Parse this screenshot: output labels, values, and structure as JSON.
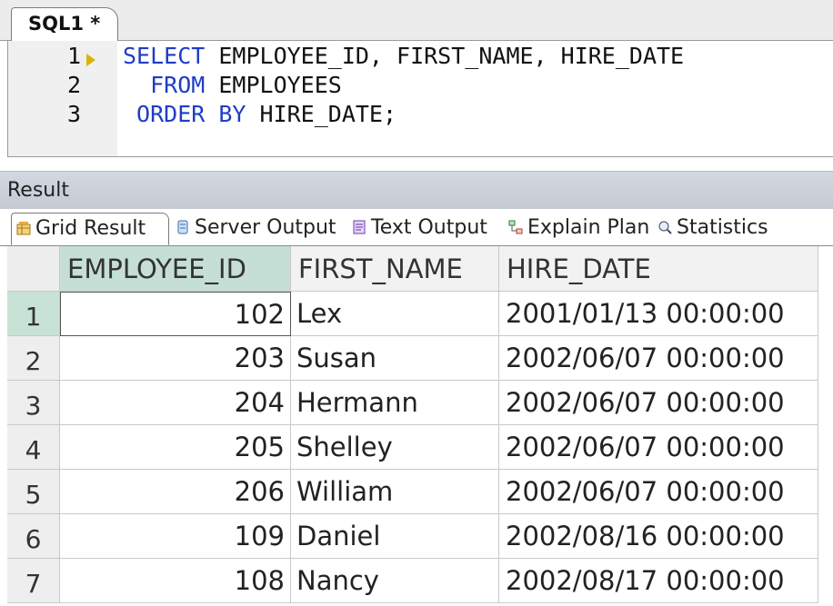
{
  "editor_tab": {
    "label": "SQL1 *"
  },
  "editor": {
    "lines": [
      {
        "num": "1",
        "parts": [
          {
            "text": "SELECT",
            "kw": true
          },
          {
            "text": " EMPLOYEE_ID, FIRST_NAME, HIRE_DATE",
            "kw": false
          }
        ]
      },
      {
        "num": "2",
        "parts": [
          {
            "text": "  FROM",
            "kw": true
          },
          {
            "text": " EMPLOYEES",
            "kw": false
          }
        ]
      },
      {
        "num": "3",
        "parts": [
          {
            "text": " ORDER BY",
            "kw": true
          },
          {
            "text": " HIRE_DATE;",
            "kw": false
          }
        ]
      }
    ]
  },
  "result": {
    "title": "Result",
    "tabs": [
      {
        "label": "Grid Result",
        "icon": "grid-result-icon",
        "active": true
      },
      {
        "label": "Server Output",
        "icon": "server-output-icon",
        "active": false
      },
      {
        "label": "Text Output",
        "icon": "text-output-icon",
        "active": false
      },
      {
        "label": "Explain Plan",
        "icon": "explain-plan-icon",
        "active": false
      },
      {
        "label": "Statistics",
        "icon": "statistics-icon",
        "active": false
      }
    ]
  },
  "grid": {
    "columns": [
      "EMPLOYEE_ID",
      "FIRST_NAME",
      "HIRE_DATE"
    ],
    "rows": [
      {
        "n": "1",
        "id": "102",
        "name": "Lex",
        "date": "2001/01/13 00:00:00"
      },
      {
        "n": "2",
        "id": "203",
        "name": "Susan",
        "date": "2002/06/07 00:00:00"
      },
      {
        "n": "3",
        "id": "204",
        "name": "Hermann",
        "date": "2002/06/07 00:00:00"
      },
      {
        "n": "4",
        "id": "205",
        "name": "Shelley",
        "date": "2002/06/07 00:00:00"
      },
      {
        "n": "5",
        "id": "206",
        "name": "William",
        "date": "2002/06/07 00:00:00"
      },
      {
        "n": "6",
        "id": "109",
        "name": "Daniel",
        "date": "2002/08/16 00:00:00"
      },
      {
        "n": "7",
        "id": "108",
        "name": "Nancy",
        "date": "2002/08/17 00:00:00"
      }
    ]
  },
  "colors": {
    "keyword": "#1f3cc8",
    "selected_header": "#c6dfd6",
    "exec_marker": "#d6b300"
  }
}
